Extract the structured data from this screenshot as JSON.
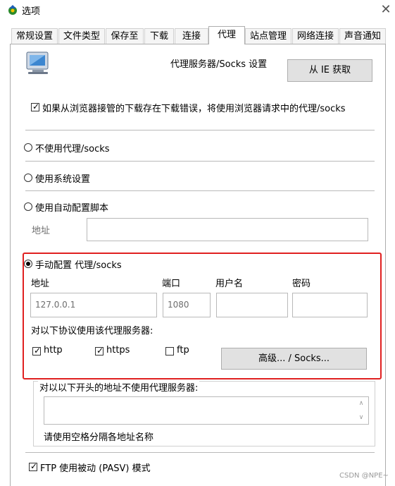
{
  "window": {
    "title": "选项",
    "close_glyph": "✕"
  },
  "tabs": [
    {
      "label": "常规设置"
    },
    {
      "label": "文件类型"
    },
    {
      "label": "保存至"
    },
    {
      "label": "下载"
    },
    {
      "label": "连接"
    },
    {
      "label": "代理",
      "active": true
    },
    {
      "label": "站点管理"
    },
    {
      "label": "网络连接"
    },
    {
      "label": "声音通知"
    }
  ],
  "header": {
    "title": "代理服务器/Socks 设置",
    "from_ie_button": "从 IE 获取"
  },
  "use_browser_proxy": {
    "label": "如果从浏览器接管的下载存在下载错误，将使用浏览器请求中的代理/socks",
    "checked": true
  },
  "options": {
    "no_proxy": "不使用代理/socks",
    "system_settings": "使用系统设置",
    "auto_script": "使用自动配置脚本",
    "auto_address_label": "地址",
    "manual": "手动配置 代理/socks",
    "selected": "manual"
  },
  "manual": {
    "address_label": "地址",
    "port_label": "端口",
    "username_label": "用户名",
    "password_label": "密码",
    "address_value": "127.0.0.1",
    "port_value": "1080",
    "username_value": "",
    "password_value": "",
    "protocols_label": "对以下协议使用该代理服务器:",
    "http": {
      "label": "http",
      "checked": true
    },
    "https": {
      "label": "https",
      "checked": true
    },
    "ftp": {
      "label": "ftp",
      "checked": false
    },
    "advanced_button": "高级... / Socks..."
  },
  "bypass": {
    "label": "对以以下开头的地址不使用代理服务器:",
    "hint": "请使用空格分隔各地址名称"
  },
  "ftp_pasv": {
    "label": "FTP 使用被动 (PASV) 模式",
    "checked": true
  },
  "watermark": "CSDN @NPE~",
  "colors": {
    "highlight_border": "#e02020",
    "button_bg": "#e1e1e1"
  }
}
